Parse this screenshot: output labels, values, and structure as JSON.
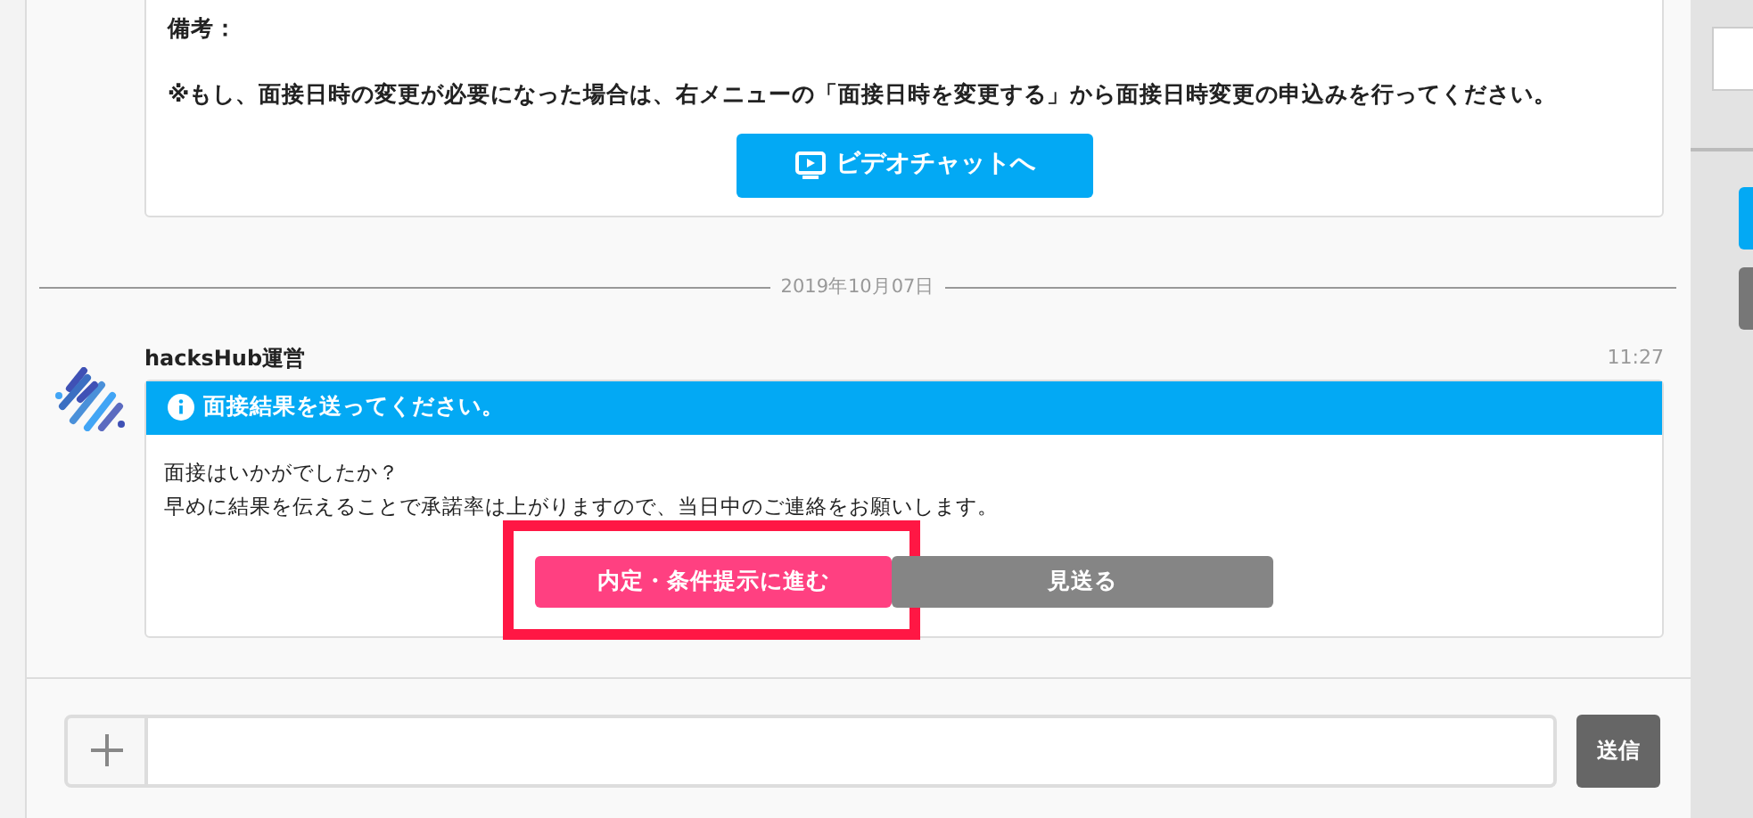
{
  "previous_card": {
    "note_label": "備考：",
    "notice": "※もし、面接日時の変更が必要になった場合は、右メニューの「面接日時を変更する」から面接日時変更の申込みを行ってください。",
    "video_button": "ビデオチャットへ"
  },
  "date_divider": "2019年10月07日",
  "message": {
    "sender": "hacksHub運営",
    "time": "11:27",
    "title": "面接結果を送ってください。",
    "lines": [
      "面接はいかがでしたか？",
      "早めに結果を伝えることで承諾率は上がりますので、当日中のご連絡をお願いします。"
    ],
    "actions": [
      {
        "label": "内定・条件提示に進む",
        "kind": "primary",
        "highlighted": true
      },
      {
        "label": "見送る",
        "kind": "secondary",
        "highlighted": false
      }
    ]
  },
  "composer": {
    "send_button": "送信"
  }
}
